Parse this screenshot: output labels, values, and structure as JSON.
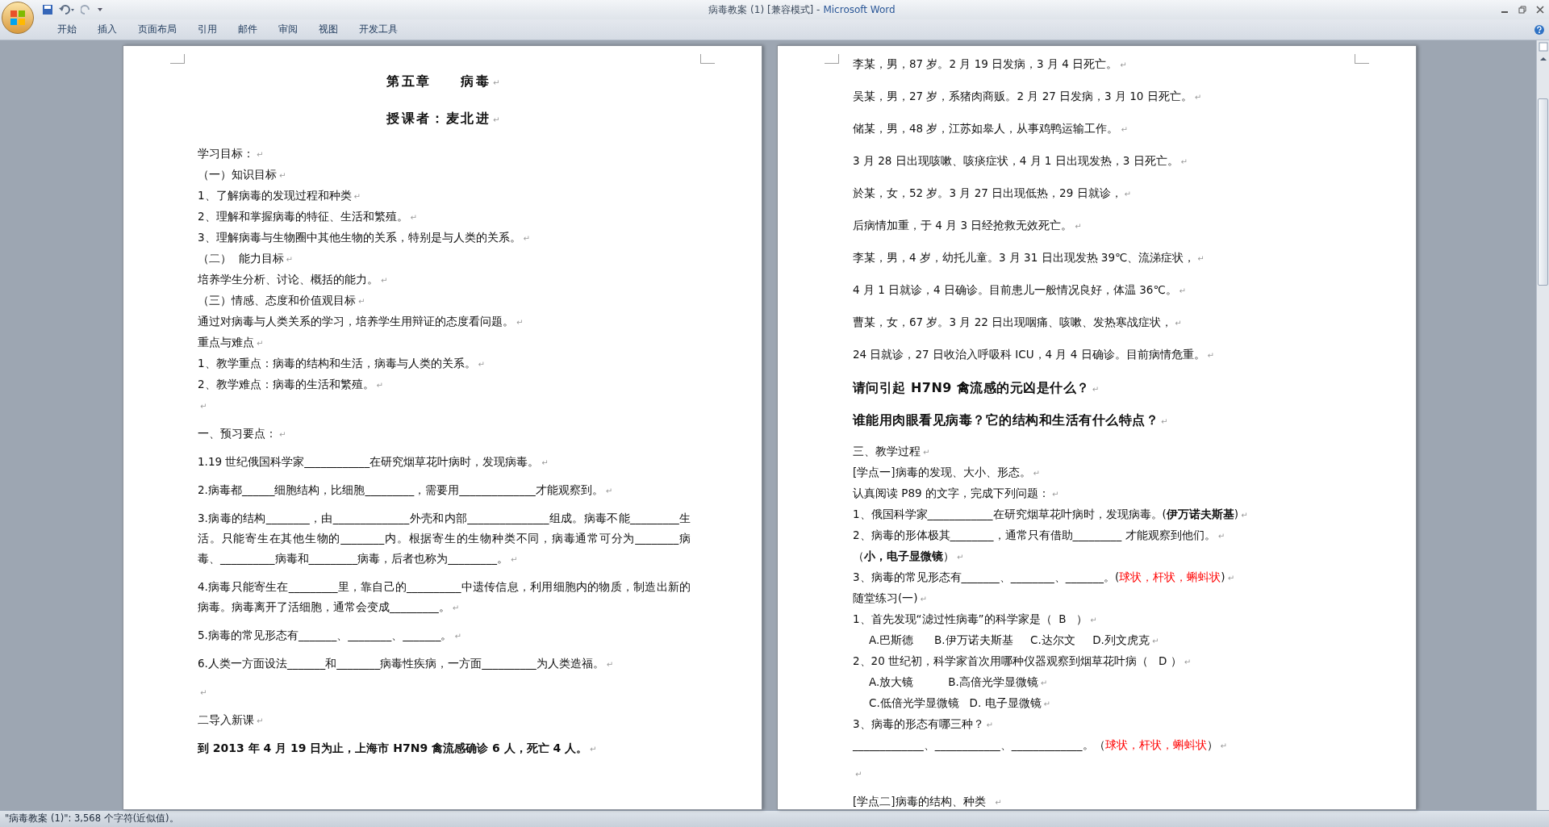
{
  "window": {
    "document": "病毒教案 (1) [兼容模式] -",
    "app": "Microsoft Word"
  },
  "tabs": [
    {
      "label": "开始",
      "selected": false
    },
    {
      "label": "插入",
      "selected": false
    },
    {
      "label": "页面布局",
      "selected": false
    },
    {
      "label": "引用",
      "selected": false
    },
    {
      "label": "邮件",
      "selected": false
    },
    {
      "label": "审阅",
      "selected": false
    },
    {
      "label": "视图",
      "selected": false
    },
    {
      "label": "开发工具",
      "selected": false
    }
  ],
  "pages": [
    {
      "paragraphs": [
        {
          "kind": "title",
          "text": "第五章　　病毒",
          "end": "↵"
        },
        {
          "kind": "title",
          "text": "授课者：麦北进",
          "end": "↵"
        },
        {
          "kind": "line",
          "text": "学习目标：",
          "end": "↵"
        },
        {
          "kind": "line",
          "text": "（一）知识目标",
          "end": "↵"
        },
        {
          "kind": "line",
          "text": "1、了解病毒的发现过程和种类",
          "end": "↵"
        },
        {
          "kind": "line",
          "text": "2、理解和掌握病毒的特征、生活和繁殖。",
          "end": "↵"
        },
        {
          "kind": "line",
          "text": "3、理解病毒与生物圈中其他生物的关系，特别是与人类的关系。",
          "end": "↵"
        },
        {
          "kind": "line",
          "text": "（二）  能力目标",
          "end": "↵"
        },
        {
          "kind": "line",
          "text": "培养学生分析、讨论、概括的能力。",
          "end": "↵"
        },
        {
          "kind": "line",
          "text": "（三）情感、态度和价值观目标",
          "end": "↵"
        },
        {
          "kind": "line",
          "text": "通过对病毒与人类关系的学习，培养学生用辩证的态度看问题。",
          "end": "↵"
        },
        {
          "kind": "line",
          "text": "重点与难点",
          "end": "↵"
        },
        {
          "kind": "line",
          "text": "1、教学重点：病毒的结构和生活，病毒与人类的关系。",
          "end": "↵"
        },
        {
          "kind": "line",
          "text": "2、教学难点：病毒的生活和繁殖。",
          "end": "↵"
        },
        {
          "kind": "spaced",
          "end": "↵"
        },
        {
          "kind": "spaced",
          "text": "一、预习要点：",
          "end": "↵"
        },
        {
          "kind": "spaced",
          "text": "1.19 世纪俄国科学家____________在研究烟草花叶病时，发现病毒。",
          "end": "↵"
        },
        {
          "kind": "spaced",
          "text": "2.病毒都______细胞结构，比细胞_________，需要用______________才能观察到。",
          "end": "↵"
        },
        {
          "kind": "spaced",
          "text": "3.病毒的结构________，由______________外壳和内部_______________组成。病毒不能_________生活。只能寄生在其他生物的________内。根据寄生的生物种类不同，病毒通常可分为________病毒、__________病毒和_________病毒，后者也称为_________。",
          "end": "↵"
        },
        {
          "kind": "spaced",
          "text": "4.病毒只能寄生在_________里，靠自己的__________中遗传信息，利用细胞内的物质，制造出新的病毒。病毒离开了活细胞，通常会变成_________。",
          "end": "↵"
        },
        {
          "kind": "spaced",
          "text": "5.病毒的常见形态有_______、________、_______。",
          "end": "↵"
        },
        {
          "kind": "spaced",
          "text": "6.人类一方面设法_______和________病毒性疾病，一方面__________为人类造福。",
          "end": "↵"
        },
        {
          "kind": "spaced",
          "end": "↵"
        },
        {
          "kind": "spaced",
          "text": "二导入新课",
          "end": "↵"
        },
        {
          "kind": "bold",
          "text": "到 2013 年 4 月 19 日为止，上海市 H7N9 禽流感确诊 6 人，死亡 4 人。",
          "end": "↵"
        }
      ]
    },
    {
      "paragraphs": [
        {
          "kind": "wide",
          "text": "李某，男，87 岁。2 月 19 日发病，3 月 4 日死亡。",
          "end": "↵"
        },
        {
          "kind": "wide",
          "text": "吴某，男，27 岁，系猪肉商贩。2 月 27 日发病，3 月 10 日死亡。",
          "end": "↵"
        },
        {
          "kind": "wide",
          "text": "储某，男，48 岁，江苏如皋人，从事鸡鸭运输工作。",
          "end": "↵"
        },
        {
          "kind": "wide",
          "text": "3 月 28 日出现咳嗽、咳痰症状，4 月 1 日出现发热，3 日死亡。",
          "end": "↵"
        },
        {
          "kind": "wide",
          "text": "於某，女，52 岁。3 月 27 日出现低热，29 日就诊，",
          "end": "↵"
        },
        {
          "kind": "wide",
          "text": "后病情加重，于 4 月 3 日经抢救无效死亡。",
          "end": "↵"
        },
        {
          "kind": "wide",
          "text": "李某，男，4 岁，幼托儿童。3 月 31 日出现发热 39℃、流涕症状，",
          "end": "↵"
        },
        {
          "kind": "wide",
          "text": "4 月 1 日就诊，4 日确诊。目前患儿一般情况良好，体温 36℃。",
          "end": "↵"
        },
        {
          "kind": "wide",
          "text": "曹某，女，67 岁。3 月 22 日出现咽痛、咳嗽、发热寒战症状，",
          "end": "↵"
        },
        {
          "kind": "wide",
          "text": "24 日就诊，27 日收治入呼吸科 ICU，4 月 4 日确诊。目前病情危重。",
          "end": "↵"
        },
        {
          "kind": "question",
          "text": "请问引起 H7N9 禽流感的元凶是什么？",
          "end": "↵"
        },
        {
          "kind": "question",
          "text": "谁能用肉眼看见病毒？它的结构和生活有什么特点？",
          "end": "↵"
        },
        {
          "kind": "line",
          "text": "三、教学过程",
          "end": "↵"
        },
        {
          "kind": "line",
          "text": "[学点一]病毒的发现、大小、形态。",
          "end": "↵"
        },
        {
          "kind": "line",
          "text": "认真阅读 P89 的文字，完成下列问题：",
          "end": "↵"
        },
        {
          "kind": "line",
          "text": "1、俄国科学家____________在研究烟草花叶病时，发现病毒。(**伊万诺夫斯基**)",
          "end": "↵"
        },
        {
          "kind": "line",
          "text": "2、病毒的形体极其________，通常只有借助_________ 才能观察到他们。",
          "end": "↵"
        },
        {
          "kind": "line",
          "text": "（**小，电子显微镜**）",
          "end": "↵"
        },
        {
          "kind": "line",
          "text": "3、病毒的常见形态有_______、________、_______。(",
          "answer": "球状，杆状，蝌蚪状",
          "close": ")",
          "end": "↵"
        },
        {
          "kind": "line",
          "text": "随堂练习(一)",
          "end": "↵"
        },
        {
          "kind": "line",
          "text": "1、首先发现“滤过性病毒”的科学家是（  B   ）",
          "end": "↵"
        },
        {
          "kind": "indent",
          "text": "A.巴斯德      B.伊万诺夫斯基     C.达尔文     D.列文虎克",
          "end": "↵"
        },
        {
          "kind": "line",
          "text": "2、20 世纪初，科学家首次用哪种仪器观察到烟草花叶病（   D ）",
          "end": "↵"
        },
        {
          "kind": "indent",
          "text": "A.放大镜          B.高倍光学显微镜",
          "end": "↵"
        },
        {
          "kind": "indent",
          "text": "C.低倍光学显微镜   D. 电子显微镜",
          "end": "↵"
        },
        {
          "kind": "line",
          "text": "3、病毒的形态有哪三种？",
          "end": "↵"
        },
        {
          "kind": "spaced",
          "text": "_____________、____________、_____________。（",
          "answer": "球状，杆状，蝌蚪状",
          "close": "）",
          "end": "↵"
        },
        {
          "kind": "spaced",
          "end": "↵"
        },
        {
          "kind": "spaced",
          "text": "[学点二]病毒的结构、种类  ",
          "end": "↵"
        }
      ]
    }
  ],
  "status_bar": {
    "text": "\"病毒教案 (1)\": 3,568 个字符(近似值)。"
  }
}
